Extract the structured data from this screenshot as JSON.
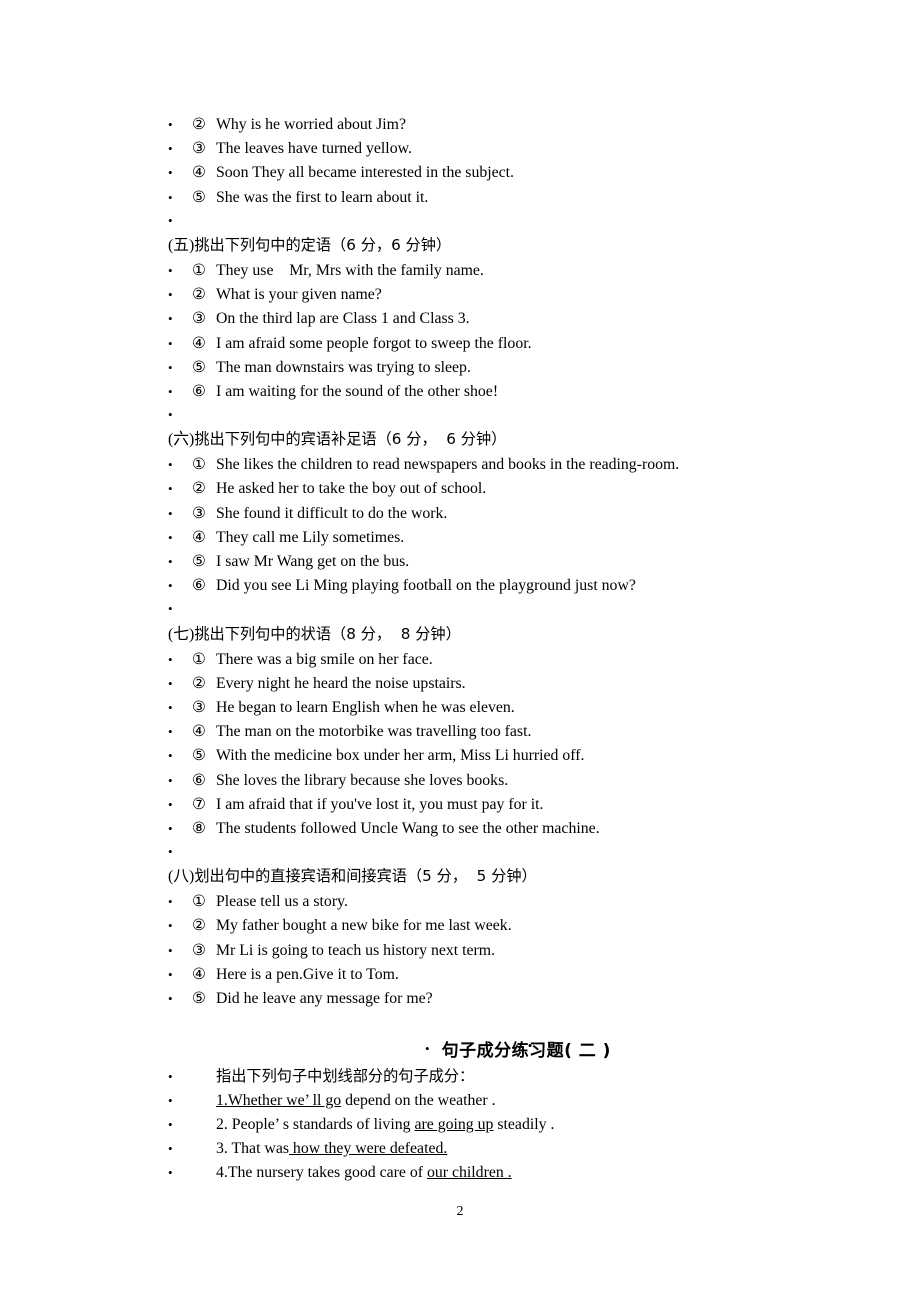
{
  "page": {
    "number": "2",
    "bullet_glyph": "•"
  },
  "top_items": [
    {
      "marker": "②",
      "text": "Why is he worried about Jim?"
    },
    {
      "marker": "③",
      "text": "The leaves have turned yellow."
    },
    {
      "marker": "④",
      "text": "Soon They all became interested in the subject."
    },
    {
      "marker": "⑤",
      "text": "She was the first to learn about it."
    }
  ],
  "sections": [
    {
      "label": "(五)",
      "heading": "挑出下列句中的定语（6 分，6 分钟）",
      "items": [
        {
          "marker": "①",
          "text": "They use    Mr, Mrs with the family name."
        },
        {
          "marker": "②",
          "text": "What is your given name?"
        },
        {
          "marker": "③",
          "text": "On the third lap are Class 1 and Class 3."
        },
        {
          "marker": "④",
          "text": "I am afraid some people forgot to sweep the floor."
        },
        {
          "marker": "⑤",
          "text": "The man downstairs was trying to sleep."
        },
        {
          "marker": "⑥",
          "text": "I am waiting for the sound of the other shoe!"
        }
      ]
    },
    {
      "label": "(六)",
      "heading": "挑出下列句中的宾语补足语（6 分，  6 分钟）",
      "items": [
        {
          "marker": "①",
          "text": "She likes the children to read newspapers and books in the reading-room."
        },
        {
          "marker": "②",
          "text": "He asked her to take the boy out of school."
        },
        {
          "marker": "③",
          "text": "She found it difficult to do the work."
        },
        {
          "marker": "④",
          "text": "They call me Lily sometimes."
        },
        {
          "marker": "⑤",
          "text": "I saw Mr Wang get on the bus."
        },
        {
          "marker": "⑥",
          "text": "Did you see Li Ming playing football on the playground just now?"
        }
      ]
    },
    {
      "label": "(七)",
      "heading": "挑出下列句中的状语（8 分，  8 分钟）",
      "items": [
        {
          "marker": "①",
          "text": "There was a big smile on her face."
        },
        {
          "marker": "②",
          "text": "Every night he heard the noise upstairs."
        },
        {
          "marker": "③",
          "text": "He began to learn English when he was eleven."
        },
        {
          "marker": "④",
          "text": "The man on the motorbike was travelling too fast."
        },
        {
          "marker": "⑤",
          "text": "With the medicine box under her arm, Miss Li hurried off."
        },
        {
          "marker": "⑥",
          "text": "She loves the library because she loves books."
        },
        {
          "marker": "⑦",
          "text": "I am afraid that if you've lost it, you must pay for it."
        },
        {
          "marker": "⑧",
          "text": "The students followed Uncle Wang to see the other machine."
        }
      ]
    },
    {
      "label": "(八)",
      "heading": "划出句中的直接宾语和间接宾语（5 分，  5 分钟）",
      "items": [
        {
          "marker": "①",
          "text": "Please tell us a story."
        },
        {
          "marker": "②",
          "text": "My father bought a new bike for me last week."
        },
        {
          "marker": "③",
          "text": "Mr Li is going to teach us history next term."
        },
        {
          "marker": "④",
          "text": "Here is a pen.Give it to Tom."
        },
        {
          "marker": "⑤",
          "text": "Did he leave any message for me?"
        }
      ]
    }
  ],
  "exercise_two": {
    "title": "句子成分练习题( 二 )",
    "instruction": "指出下列句子中划线部分的句子成分：",
    "questions": [
      {
        "underlined_lead": "1.Whether we’ ll go",
        "rest": " depend on the weather ."
      },
      {
        "plain_lead": "2. People’ s standards of living ",
        "underlined_mid": "are going up",
        "rest": " steadily ."
      },
      {
        "plain_lead": "3. That was",
        "underlined_mid": " how they were defeated.",
        "rest": ""
      },
      {
        "plain_lead": "4.The nursery takes good care of ",
        "underlined_mid": "our children .",
        "rest": ""
      }
    ]
  }
}
